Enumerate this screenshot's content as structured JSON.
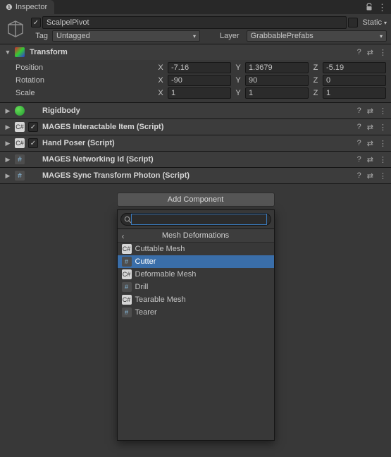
{
  "tab": {
    "title": "Inspector"
  },
  "object": {
    "enabled": true,
    "name": "ScalpelPivot",
    "static_label": "Static",
    "tag_label": "Tag",
    "tag_value": "Untagged",
    "layer_label": "Layer",
    "layer_value": "GrabbablePrefabs"
  },
  "transform": {
    "title": "Transform",
    "rows": {
      "position": {
        "label": "Position",
        "x": "-7.16",
        "y": "1.3679",
        "z": "-5.19"
      },
      "rotation": {
        "label": "Rotation",
        "x": "-90",
        "y": "90",
        "z": "0"
      },
      "scale": {
        "label": "Scale",
        "x": "1",
        "y": "1",
        "z": "1"
      }
    },
    "axes": {
      "x": "X",
      "y": "Y",
      "z": "Z"
    }
  },
  "components": [
    {
      "title": "Rigidbody",
      "icon": "rigidbody",
      "checkbox": null
    },
    {
      "title": "MAGES Interactable Item (Script)",
      "icon": "script",
      "checkbox": true
    },
    {
      "title": "Hand Poser (Script)",
      "icon": "script",
      "checkbox": true
    },
    {
      "title": "MAGES Networking Id (Script)",
      "icon": "hash",
      "checkbox": null
    },
    {
      "title": "MAGES Sync Transform Photon (Script)",
      "icon": "hash",
      "checkbox": null
    }
  ],
  "add_component": {
    "button_label": "Add Component",
    "search_value": "",
    "search_placeholder": "",
    "category": "Mesh Deformations",
    "items": [
      {
        "label": "Cuttable Mesh",
        "icon": "c",
        "selected": false
      },
      {
        "label": "Cutter",
        "icon": "h",
        "selected": true
      },
      {
        "label": "Deformable Mesh",
        "icon": "c",
        "selected": false
      },
      {
        "label": "Drill",
        "icon": "h",
        "selected": false
      },
      {
        "label": "Tearable Mesh",
        "icon": "c",
        "selected": false
      },
      {
        "label": "Tearer",
        "icon": "h",
        "selected": false
      }
    ]
  }
}
